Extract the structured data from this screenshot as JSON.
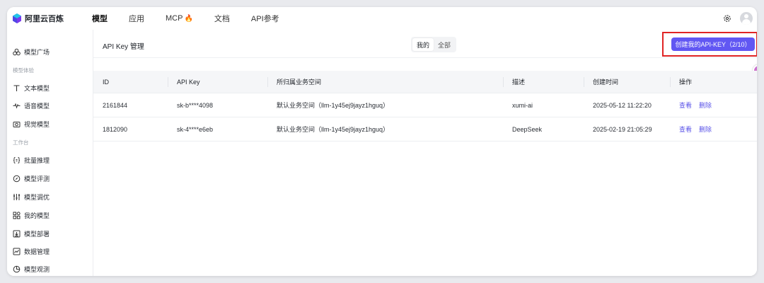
{
  "brand": {
    "name": "阿里云百炼"
  },
  "topnav": [
    {
      "label": "模型",
      "active": true
    },
    {
      "label": "应用",
      "active": false
    },
    {
      "label": "MCP",
      "active": false,
      "badge": "🔥"
    },
    {
      "label": "文档",
      "active": false
    },
    {
      "label": "API参考",
      "active": false
    }
  ],
  "sidebar": {
    "items": [
      {
        "label": "模型广场",
        "icon": "cloud-icon"
      }
    ],
    "section1": "模型体验",
    "exp_items": [
      {
        "label": "文本模型",
        "icon": "text-icon"
      },
      {
        "label": "语音模型",
        "icon": "audio-icon"
      },
      {
        "label": "视觉模型",
        "icon": "camera-icon"
      }
    ],
    "section2": "工作台",
    "work_items": [
      {
        "label": "批量推理",
        "icon": "braces-icon"
      },
      {
        "label": "模型评测",
        "icon": "compass-icon"
      },
      {
        "label": "模型调优",
        "icon": "sliders-icon"
      },
      {
        "label": "我的模型",
        "icon": "grid-icon"
      },
      {
        "label": "模型部署",
        "icon": "deploy-icon"
      },
      {
        "label": "数据管理",
        "icon": "chart-icon"
      },
      {
        "label": "模型观测",
        "icon": "pie-icon"
      }
    ]
  },
  "panel": {
    "title": "API Key 管理",
    "seg": {
      "mine": "我的",
      "all": "全部"
    },
    "create_label": "创建我的API-KEY（2/10）"
  },
  "table": {
    "headers": [
      "ID",
      "API Key",
      "所归属业务空间",
      "描述",
      "创建时间",
      "操作"
    ],
    "rows": [
      {
        "id": "2161844",
        "key": "sk-b****4098",
        "space": "默认业务空间（llm-1y45ej9jayz1hguq）",
        "desc": "xumi-ai",
        "time": "2025-05-12 11:22:20",
        "view": "查看",
        "del": "删除"
      },
      {
        "id": "1812090",
        "key": "sk-4****e6eb",
        "space": "默认业务空间（llm-1y45ej9jayz1hguq）",
        "desc": "DeepSeek",
        "time": "2025-02-19 21:05:29",
        "view": "查看",
        "del": "删除"
      }
    ]
  },
  "colors": {
    "accent": "#6157f3",
    "highlight": "#e02424"
  }
}
